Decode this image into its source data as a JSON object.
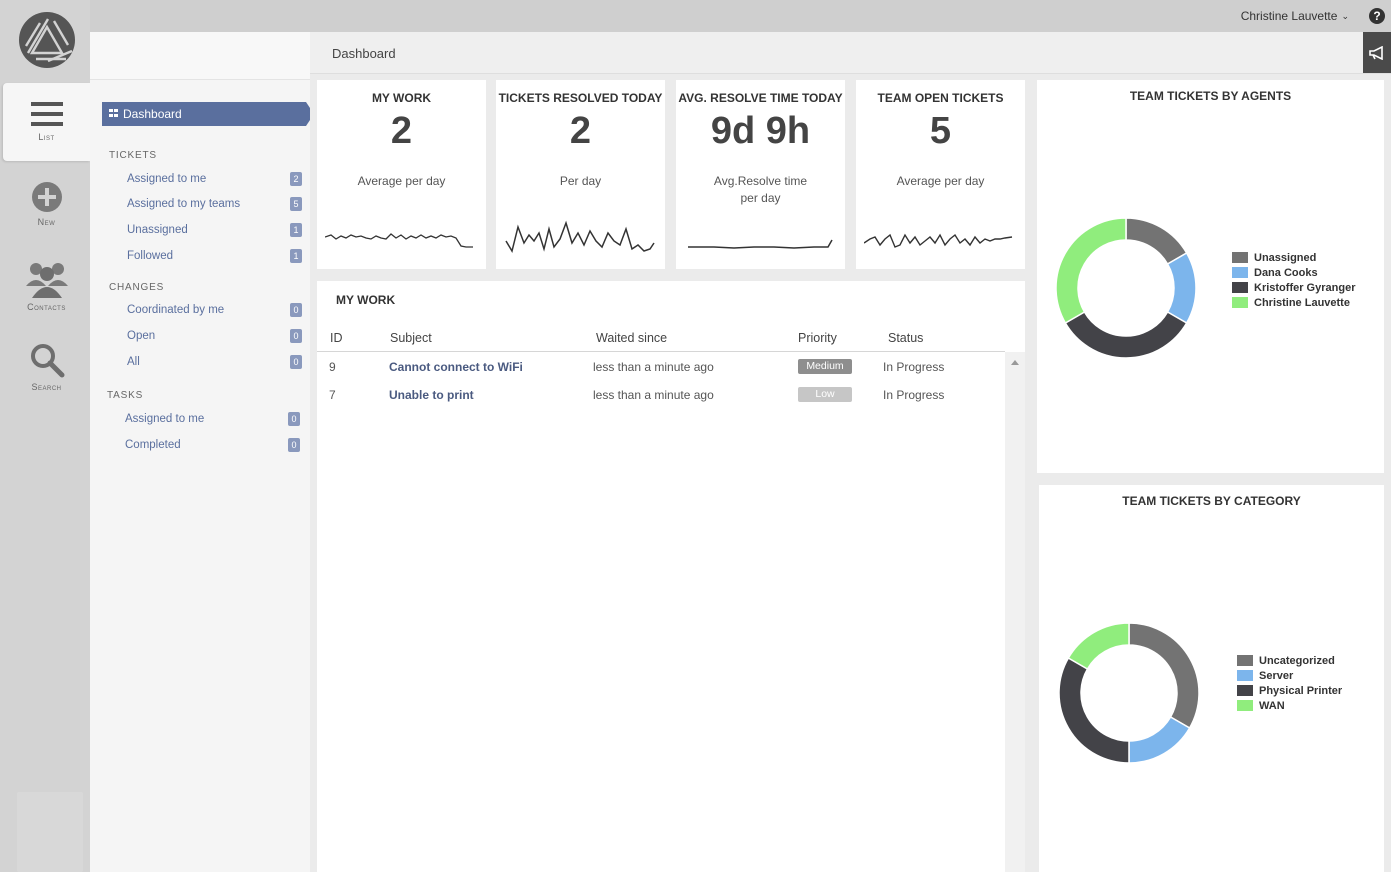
{
  "user": {
    "name": "Christine Lauvette"
  },
  "rail": {
    "items": [
      {
        "label": "List"
      },
      {
        "label": "New"
      },
      {
        "label": "Contacts"
      },
      {
        "label": "Search"
      }
    ]
  },
  "nav": {
    "active": "Dashboard",
    "sections": [
      {
        "title": "TICKETS",
        "items": [
          {
            "label": "Assigned to me",
            "count": "2"
          },
          {
            "label": "Assigned to my teams",
            "count": "5"
          },
          {
            "label": "Unassigned",
            "count": "1"
          },
          {
            "label": "Followed",
            "count": "1"
          }
        ]
      },
      {
        "title": "CHANGES",
        "items": [
          {
            "label": "Coordinated by me",
            "count": "0"
          },
          {
            "label": "Open",
            "count": "0"
          },
          {
            "label": "All",
            "count": "0"
          }
        ]
      },
      {
        "title": "TASKS",
        "items": [
          {
            "label": "Assigned to me",
            "count": "0"
          },
          {
            "label": "Completed",
            "count": "0"
          }
        ]
      }
    ]
  },
  "header": {
    "title": "Dashboard"
  },
  "kpis": [
    {
      "title": "MY WORK",
      "value": "2",
      "sub": "Average per day"
    },
    {
      "title": "TICKETS RESOLVED TODAY",
      "value": "2",
      "sub": "Per day"
    },
    {
      "title": "AVG. RESOLVE TIME TODAY",
      "value": "9d 9h",
      "sub": "Avg.Resolve time per day"
    },
    {
      "title": "TEAM OPEN TICKETS",
      "value": "5",
      "sub": "Average per day"
    }
  ],
  "my_work": {
    "title": "MY WORK",
    "columns": [
      "ID",
      "Subject",
      "Waited since",
      "Priority",
      "Status"
    ],
    "rows": [
      {
        "id": "9",
        "subject": "Cannot connect to WiFi",
        "waited": "less than a minute ago",
        "priority": "Medium",
        "status": "In Progress"
      },
      {
        "id": "7",
        "subject": "Unable to print",
        "waited": "less than a minute ago",
        "priority": "Low",
        "status": "In Progress"
      }
    ]
  },
  "colors": {
    "accent": "#5a6f9e",
    "prio_medium": "#8e8e8e",
    "prio_low": "#c6c6c6"
  },
  "chart_data": [
    {
      "type": "pie",
      "title": "TEAM TICKETS BY AGENTS",
      "labels": [
        "Unassigned",
        "Dana Cooks",
        "Kristoffer Gyranger",
        "Christine Lauvette"
      ],
      "values": [
        1,
        1,
        2,
        2
      ],
      "colors": [
        "#737373",
        "#7cb5ec",
        "#434348",
        "#90ed7d"
      ],
      "legend": "right"
    },
    {
      "type": "pie",
      "title": "TEAM TICKETS BY CATEGORY",
      "labels": [
        "Uncategorized",
        "Server",
        "Physical Printer",
        "WAN"
      ],
      "values": [
        2,
        1,
        2,
        1
      ],
      "colors": [
        "#737373",
        "#7cb5ec",
        "#434348",
        "#90ed7d"
      ],
      "legend": "right"
    }
  ]
}
